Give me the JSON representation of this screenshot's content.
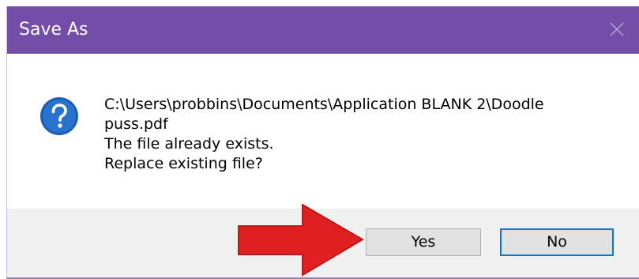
{
  "dialog": {
    "title": "Save As",
    "title_bar_color": "#744da9",
    "close_icon": "close-icon",
    "message_icon": "question-icon",
    "message_lines": [
      "C:\\Users\\probbins\\Documents\\Application BLANK 2\\Doodle",
      "puss.pdf",
      "The file already exists.",
      "Replace existing file?"
    ],
    "buttons": {
      "yes_label": "Yes",
      "no_label": "No"
    },
    "annotation": {
      "arrow_color": "#e02020",
      "arrow_icon": "arrow-right-icon"
    }
  }
}
